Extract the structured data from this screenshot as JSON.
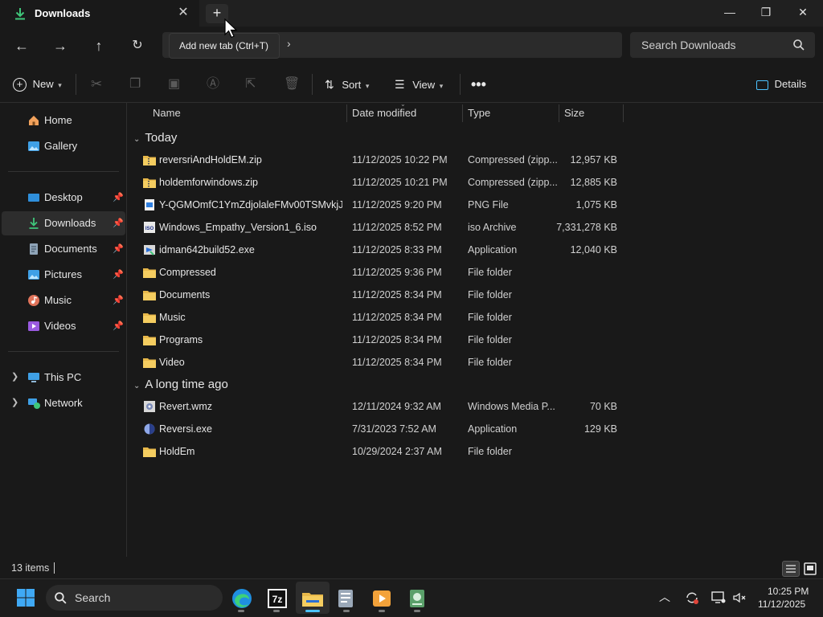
{
  "tab": {
    "title": "Downloads",
    "close_icon": "close-icon"
  },
  "window_controls": {
    "minimize": "—",
    "maximize": "❐",
    "close": "✕"
  },
  "newtab_tooltip": "Add new tab (Ctrl+T)",
  "search": {
    "placeholder": "Search Downloads"
  },
  "command_bar": {
    "new_label": "New",
    "sort_label": "Sort",
    "view_label": "View",
    "details_label": "Details"
  },
  "sidebar": {
    "top": [
      {
        "label": "Home",
        "icon": "home-icon"
      },
      {
        "label": "Gallery",
        "icon": "gallery-icon"
      }
    ],
    "pinned": [
      {
        "label": "Desktop",
        "icon": "desktop-icon"
      },
      {
        "label": "Downloads",
        "icon": "downloads-icon"
      },
      {
        "label": "Documents",
        "icon": "documents-icon"
      },
      {
        "label": "Pictures",
        "icon": "pictures-icon"
      },
      {
        "label": "Music",
        "icon": "music-icon"
      },
      {
        "label": "Videos",
        "icon": "videos-icon"
      }
    ],
    "bottom": [
      {
        "label": "This PC",
        "icon": "this-pc-icon"
      },
      {
        "label": "Network",
        "icon": "network-icon"
      }
    ]
  },
  "columns": {
    "name": "Name",
    "date": "Date modified",
    "type": "Type",
    "size": "Size"
  },
  "groups": [
    {
      "label": "Today",
      "files": [
        {
          "name": "reversriAndHoldEM.zip",
          "date": "11/12/2025 10:22 PM",
          "type": "Compressed (zipp...",
          "size": "12,957 KB",
          "icon": "zip-icon"
        },
        {
          "name": "holdemforwindows.zip",
          "date": "11/12/2025 10:21 PM",
          "type": "Compressed (zipp...",
          "size": "12,885 KB",
          "icon": "zip-icon"
        },
        {
          "name": "Y-QGMOmfC1YmZdjolaleFMv00TSMvkjJ...",
          "date": "11/12/2025 9:20 PM",
          "type": "PNG File",
          "size": "1,075 KB",
          "icon": "png-icon"
        },
        {
          "name": "Windows_Empathy_Version1_6.iso",
          "date": "11/12/2025 8:52 PM",
          "type": "iso Archive",
          "size": "7,331,278 KB",
          "icon": "iso-icon"
        },
        {
          "name": "idman642build52.exe",
          "date": "11/12/2025 8:33 PM",
          "type": "Application",
          "size": "12,040 KB",
          "icon": "exe-icon"
        },
        {
          "name": "Compressed",
          "date": "11/12/2025 9:36 PM",
          "type": "File folder",
          "size": "",
          "icon": "folder-icon"
        },
        {
          "name": "Documents",
          "date": "11/12/2025 8:34 PM",
          "type": "File folder",
          "size": "",
          "icon": "folder-icon"
        },
        {
          "name": "Music",
          "date": "11/12/2025 8:34 PM",
          "type": "File folder",
          "size": "",
          "icon": "folder-icon"
        },
        {
          "name": "Programs",
          "date": "11/12/2025 8:34 PM",
          "type": "File folder",
          "size": "",
          "icon": "folder-icon"
        },
        {
          "name": "Video",
          "date": "11/12/2025 8:34 PM",
          "type": "File folder",
          "size": "",
          "icon": "folder-icon"
        }
      ]
    },
    {
      "label": "A long time ago",
      "files": [
        {
          "name": "Revert.wmz",
          "date": "12/11/2024 9:32 AM",
          "type": "Windows Media P...",
          "size": "70 KB",
          "icon": "wmz-icon"
        },
        {
          "name": "Reversi.exe",
          "date": "7/31/2023 7:52 AM",
          "type": "Application",
          "size": "129 KB",
          "icon": "reversi-icon"
        },
        {
          "name": "HoldEm",
          "date": "10/29/2024 2:37 AM",
          "type": "File folder",
          "size": "",
          "icon": "folder-icon"
        }
      ]
    }
  ],
  "status": {
    "item_count": "13 items"
  },
  "taskbar": {
    "search_label": "Search",
    "apps": [
      "edge-icon",
      "7zip-icon",
      "file-explorer-icon",
      "app-icon",
      "media-player-icon",
      "installer-icon"
    ],
    "clock_time": "10:25 PM",
    "clock_date": "11/12/2025"
  },
  "colors": {
    "background": "#191919",
    "accent": "#4cc2ff",
    "folder": "#e8b84a"
  }
}
